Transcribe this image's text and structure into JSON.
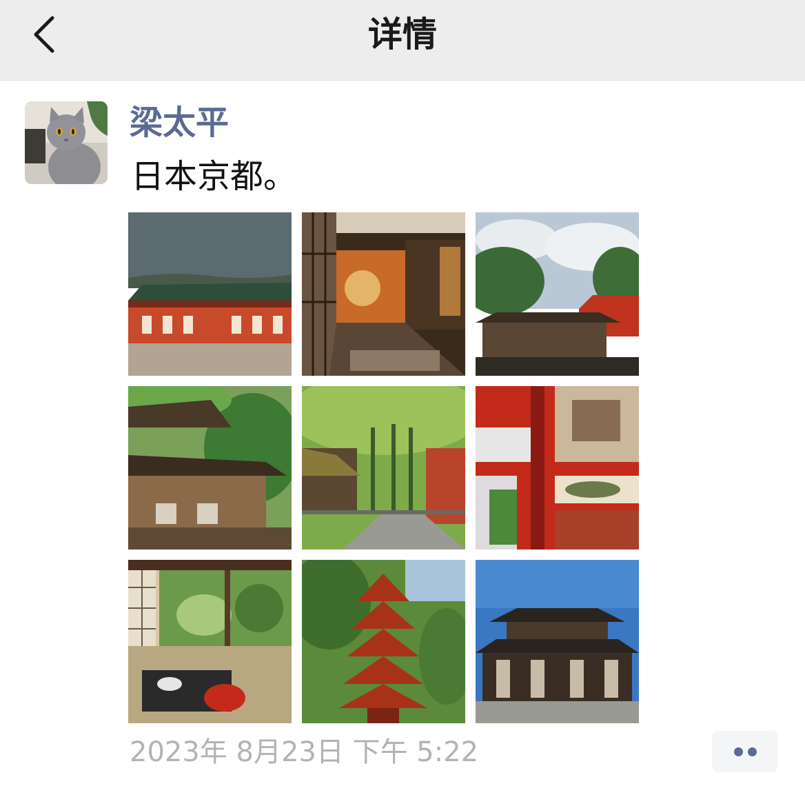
{
  "header": {
    "title": "详情",
    "back_icon": "chevron-left-icon"
  },
  "post": {
    "author": "梁太平",
    "text": "日本京都。",
    "avatar_icon": "cat-avatar",
    "photos": [
      {
        "subject": "red temple hall under grey sky"
      },
      {
        "subject": "interior corridor with peacock painting"
      },
      {
        "subject": "wooden gate with red building under cloudy sky"
      },
      {
        "subject": "wooden pagoda roof among green trees"
      },
      {
        "subject": "forest path with shrine lanterns"
      },
      {
        "subject": "red shrine panels with lattice window"
      },
      {
        "subject": "tatami room with garden view and lacquer meal"
      },
      {
        "subject": "red five-story pagoda in forest"
      },
      {
        "subject": "dark wooden temple gate under blue sky"
      }
    ],
    "timestamp": "2023年 8月23日 下午 5:22",
    "more_icon": "more-dots-icon"
  },
  "colors": {
    "author": "#5b6b93",
    "timestamp": "#b3b3b3",
    "header_bg": "#ededed"
  }
}
